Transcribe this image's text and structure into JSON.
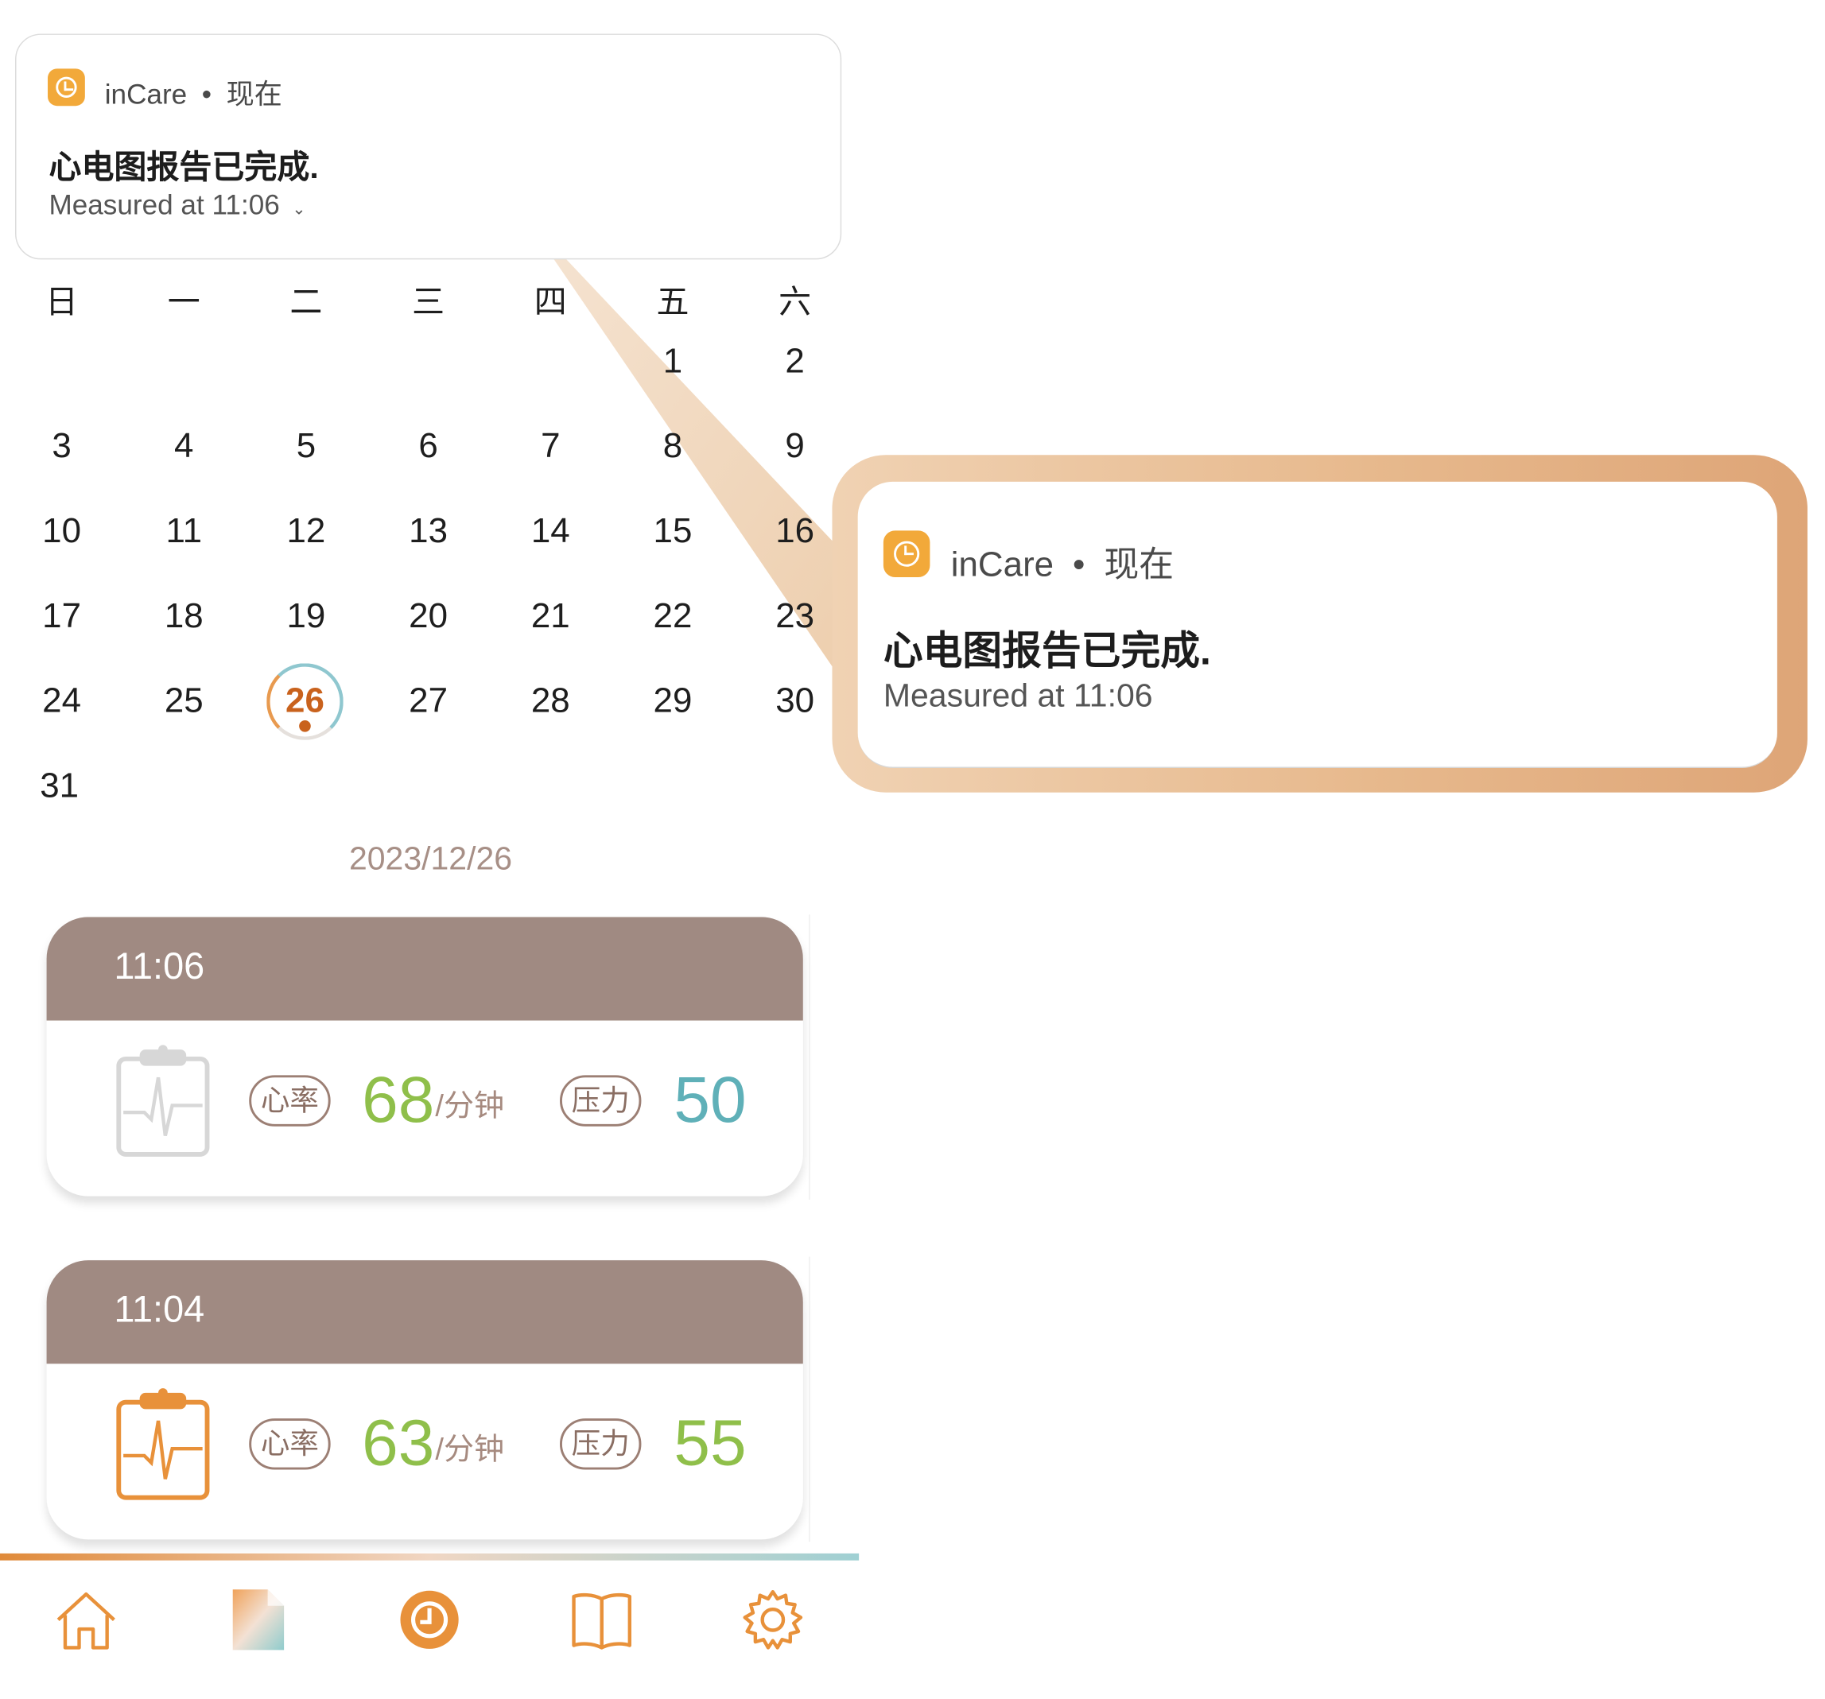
{
  "notification": {
    "app_name": "inCare",
    "separator": "•",
    "time": "现在",
    "title": "心电图报告已完成.",
    "body": "Measured at 11:06",
    "body_truncated_marker": "⌄"
  },
  "calendar": {
    "weekdays": [
      "日",
      "一",
      "二",
      "三",
      "四",
      "五",
      "六"
    ],
    "weeks": [
      [
        "",
        "",
        "",
        "",
        "",
        "1",
        "2"
      ],
      [
        "3",
        "4",
        "5",
        "6",
        "7",
        "8",
        "9"
      ],
      [
        "10",
        "11",
        "12",
        "13",
        "14",
        "15",
        "16"
      ],
      [
        "17",
        "18",
        "19",
        "20",
        "21",
        "22",
        "23"
      ],
      [
        "24",
        "25",
        "26",
        "27",
        "28",
        "29",
        "30"
      ],
      [
        "31",
        "",
        "",
        "",
        "",
        "",
        ""
      ]
    ],
    "selected_day": "26",
    "selected_date_label": "2023/12/26"
  },
  "records": [
    {
      "time": "11:06",
      "hr_label": "心率",
      "hr_value": "68",
      "hr_unit": "/分钟",
      "stress_label": "压力",
      "stress_value": "50",
      "icon": "ecg-report-icon-gray",
      "stress_color": "#5fb0b8"
    },
    {
      "time": "11:04",
      "hr_label": "心率",
      "hr_value": "63",
      "hr_unit": "/分钟",
      "stress_label": "压力",
      "stress_value": "55",
      "icon": "ecg-report-icon-orange",
      "stress_color": "#8fbf4a"
    }
  ],
  "colors": {
    "accent_orange": "#e8913a",
    "card_header": "#a08a82",
    "hr_green": "#8fbf4a"
  },
  "nav": [
    "home-icon",
    "report-icon",
    "history-clock-icon",
    "book-icon",
    "settings-gear-icon"
  ]
}
